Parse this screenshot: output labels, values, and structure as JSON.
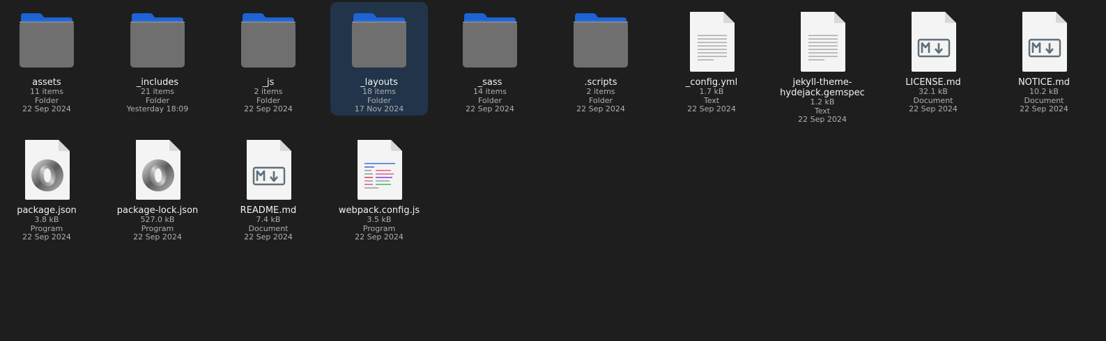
{
  "window": {
    "background": "#1e1e1e",
    "accent": "#2a66d6",
    "selection": "#223449"
  },
  "files": [
    {
      "name": "assets",
      "size": "11 items",
      "type": "Folder",
      "modified": "22 Sep 2024",
      "icon": "folder-icon",
      "kind": "folder"
    },
    {
      "name": "_includes",
      "size": "21 items",
      "type": "Folder",
      "modified": "Yesterday 18:09",
      "icon": "folder-icon",
      "kind": "folder"
    },
    {
      "name": "_js",
      "size": "2 items",
      "type": "Folder",
      "modified": "22 Sep 2024",
      "icon": "folder-icon",
      "kind": "folder"
    },
    {
      "name": "_layouts",
      "size": "18 items",
      "type": "Folder",
      "modified": "17 Nov 2024",
      "icon": "folder-icon",
      "kind": "folder",
      "selected": true
    },
    {
      "name": "_sass",
      "size": "14 items",
      "type": "Folder",
      "modified": "22 Sep 2024",
      "icon": "folder-icon",
      "kind": "folder"
    },
    {
      "name": ".scripts",
      "size": "2 items",
      "type": "Folder",
      "modified": "22 Sep 2024",
      "icon": "folder-icon",
      "kind": "folder"
    },
    {
      "name": "_config.yml",
      "size": "1.7 kB",
      "type": "Text",
      "modified": "22 Sep 2024",
      "icon": "text-file-icon",
      "kind": "text"
    },
    {
      "name": "jekyll-theme-hydejack.gemspec",
      "size": "1.2 kB",
      "type": "Text",
      "modified": "22 Sep 2024",
      "icon": "text-file-icon",
      "kind": "text"
    },
    {
      "name": "LICENSE.md",
      "size": "32.1 kB",
      "type": "Document",
      "modified": "22 Sep 2024",
      "icon": "markdown-file-icon",
      "kind": "markdown"
    },
    {
      "name": "NOTICE.md",
      "size": "10.2 kB",
      "type": "Document",
      "modified": "22 Sep 2024",
      "icon": "markdown-file-icon",
      "kind": "markdown"
    },
    {
      "name": "package.json",
      "size": "3.8 kB",
      "type": "Program",
      "modified": "22 Sep 2024",
      "icon": "json-file-icon",
      "kind": "json"
    },
    {
      "name": "package-lock.json",
      "size": "527.0 kB",
      "type": "Program",
      "modified": "22 Sep 2024",
      "icon": "json-file-icon",
      "kind": "json"
    },
    {
      "name": "README.md",
      "size": "7.4 kB",
      "type": "Document",
      "modified": "22 Sep 2024",
      "icon": "markdown-file-icon",
      "kind": "markdown"
    },
    {
      "name": "webpack.config.js",
      "size": "3.5 kB",
      "type": "Program",
      "modified": "22 Sep 2024",
      "icon": "script-file-icon",
      "kind": "script"
    }
  ]
}
